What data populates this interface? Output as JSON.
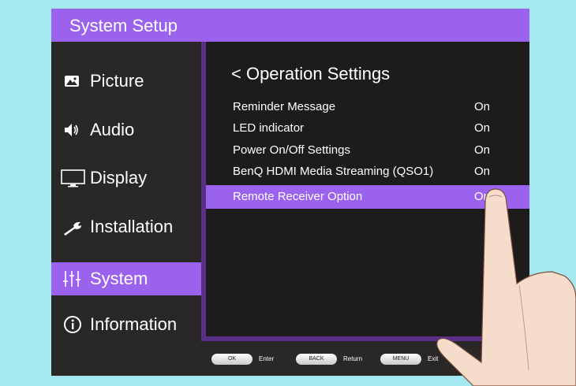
{
  "header": {
    "title": "System Setup"
  },
  "sidebar": {
    "items": [
      {
        "label": "Picture",
        "icon": "image-icon"
      },
      {
        "label": "Audio",
        "icon": "speaker-icon"
      },
      {
        "label": "Display",
        "icon": "monitor-icon"
      },
      {
        "label": "Installation",
        "icon": "wrench-icon"
      },
      {
        "label": "System",
        "icon": "sliders-icon",
        "active": true
      },
      {
        "label": "Information",
        "icon": "info-icon"
      }
    ]
  },
  "panel": {
    "title": "< Operation Settings",
    "rows": [
      {
        "name": "Reminder Message",
        "value": "On"
      },
      {
        "name": "LED indicator",
        "value": "On"
      },
      {
        "name": "Power On/Off Settings",
        "value": "On"
      },
      {
        "name": "BenQ HDMI Media Streaming (QSO1)",
        "value": "On"
      },
      {
        "name": "Remote Receiver Option",
        "value": "On",
        "active": true
      }
    ]
  },
  "footer": {
    "hints": [
      {
        "key": "OK",
        "action": "Enter"
      },
      {
        "key": "BACK",
        "action": "Return"
      },
      {
        "key": "MENU",
        "action": "Exit"
      }
    ]
  },
  "colors": {
    "accent": "#9b62ee",
    "background": "#a6e8f2",
    "menu_bg": "#2a2727",
    "panel_bg": "#1d1b1b"
  }
}
